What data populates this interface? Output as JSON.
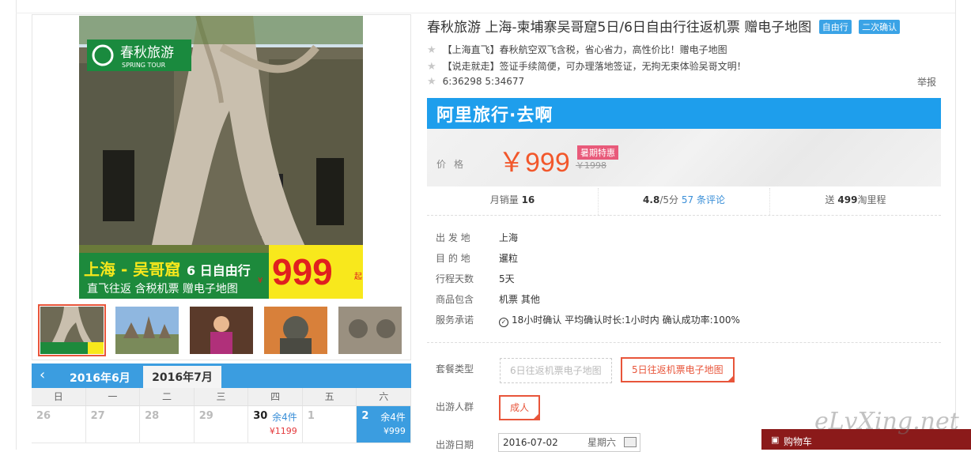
{
  "title": "春秋旅游 上海-柬埔寨吴哥窟5日/6日自由行往返机票 赠电子地图",
  "badges": [
    "自由行",
    "二次确认"
  ],
  "bullets": [
    "【上海直飞】春秋航空双飞含税，省心省力，高性价比！赠电子地图",
    "【说走就走】签证手续简便，可办理落地签证，无拘无束体验吴哥文明！",
    "6:36298 5:34677"
  ],
  "report_label": "举报",
  "brand_banner": "阿里旅行·去啊",
  "price": {
    "label": "价格",
    "current": "￥999",
    "tag": "暑期特惠",
    "original": "￥1998"
  },
  "stats": {
    "monthly_sales_label": "月销量",
    "monthly_sales_value": "16",
    "rating_value": "4.8",
    "rating_suffix": "/5分",
    "reviews_count": "57",
    "reviews_label": "条评论",
    "points_prefix": "送",
    "points_value": "499",
    "points_suffix": "淘里程"
  },
  "info": [
    {
      "label": "出 发 地",
      "value": "上海"
    },
    {
      "label": "目 的 地",
      "value": "暹粒"
    },
    {
      "label": "行程天数",
      "value": "5天"
    },
    {
      "label": "商品包含",
      "value": "机票  其他"
    },
    {
      "label": "服务承诺",
      "value": "18小时确认    平均确认时长:1小时内    确认成功率:100%"
    }
  ],
  "package": {
    "label": "套餐类型",
    "options": [
      "6日往返机票电子地图",
      "5日往返机票电子地图"
    ]
  },
  "travelers": {
    "label": "出游人群",
    "options": [
      "成人"
    ]
  },
  "travel_date": {
    "label": "出游日期",
    "value": "2016-07-02",
    "weekday": "星期六"
  },
  "cart_label": "购物车",
  "watermark": "eLvXing.net",
  "main_image": {
    "logo_cn": "春秋旅游",
    "logo_en": "SPRING TOUR",
    "headline": "上海 - 吴哥窟",
    "headline_suffix": "6 日自由行",
    "subline": "直飞往返 含税机票 赠电子地图",
    "price_currency": "¥",
    "price": "999",
    "price_suffix": "起"
  },
  "calendar": {
    "prev_icon": "‹",
    "months": [
      "2016年6月",
      "2016年7月"
    ],
    "weekdays": [
      "日",
      "一",
      "二",
      "三",
      "四",
      "五",
      "六"
    ],
    "days": [
      {
        "d": "26",
        "rem": "",
        "pr": ""
      },
      {
        "d": "27",
        "rem": "",
        "pr": ""
      },
      {
        "d": "28",
        "rem": "",
        "pr": ""
      },
      {
        "d": "29",
        "rem": "",
        "pr": ""
      },
      {
        "d": "30",
        "rem": "余4件",
        "pr": "¥1199"
      },
      {
        "d": "1",
        "rem": "",
        "pr": ""
      },
      {
        "d": "2",
        "rem": "余4件",
        "pr": "¥999"
      }
    ]
  },
  "colors": {
    "accent_orange": "#e8553a",
    "brand_blue": "#1e9eec",
    "price_red": "#f2572b"
  }
}
